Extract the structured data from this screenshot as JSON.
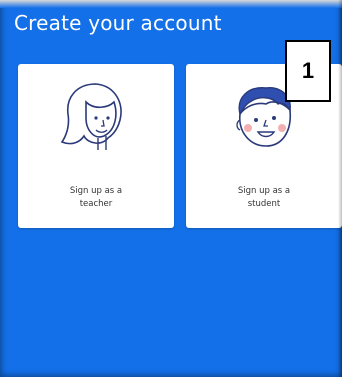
{
  "page": {
    "title": "Create your account"
  },
  "options": [
    {
      "id": "teacher",
      "label": "Sign up as a\nteacher",
      "icon": "teacher-face-icon"
    },
    {
      "id": "student",
      "label": "Sign up as a\nstudent",
      "icon": "student-face-icon"
    }
  ],
  "annotation": {
    "badge_number": "1"
  },
  "colors": {
    "background": "#1470e8",
    "card": "#ffffff",
    "line_art": "#2a3a7a",
    "hair": "#2f4fb0",
    "cheek": "#f3b0b0"
  }
}
